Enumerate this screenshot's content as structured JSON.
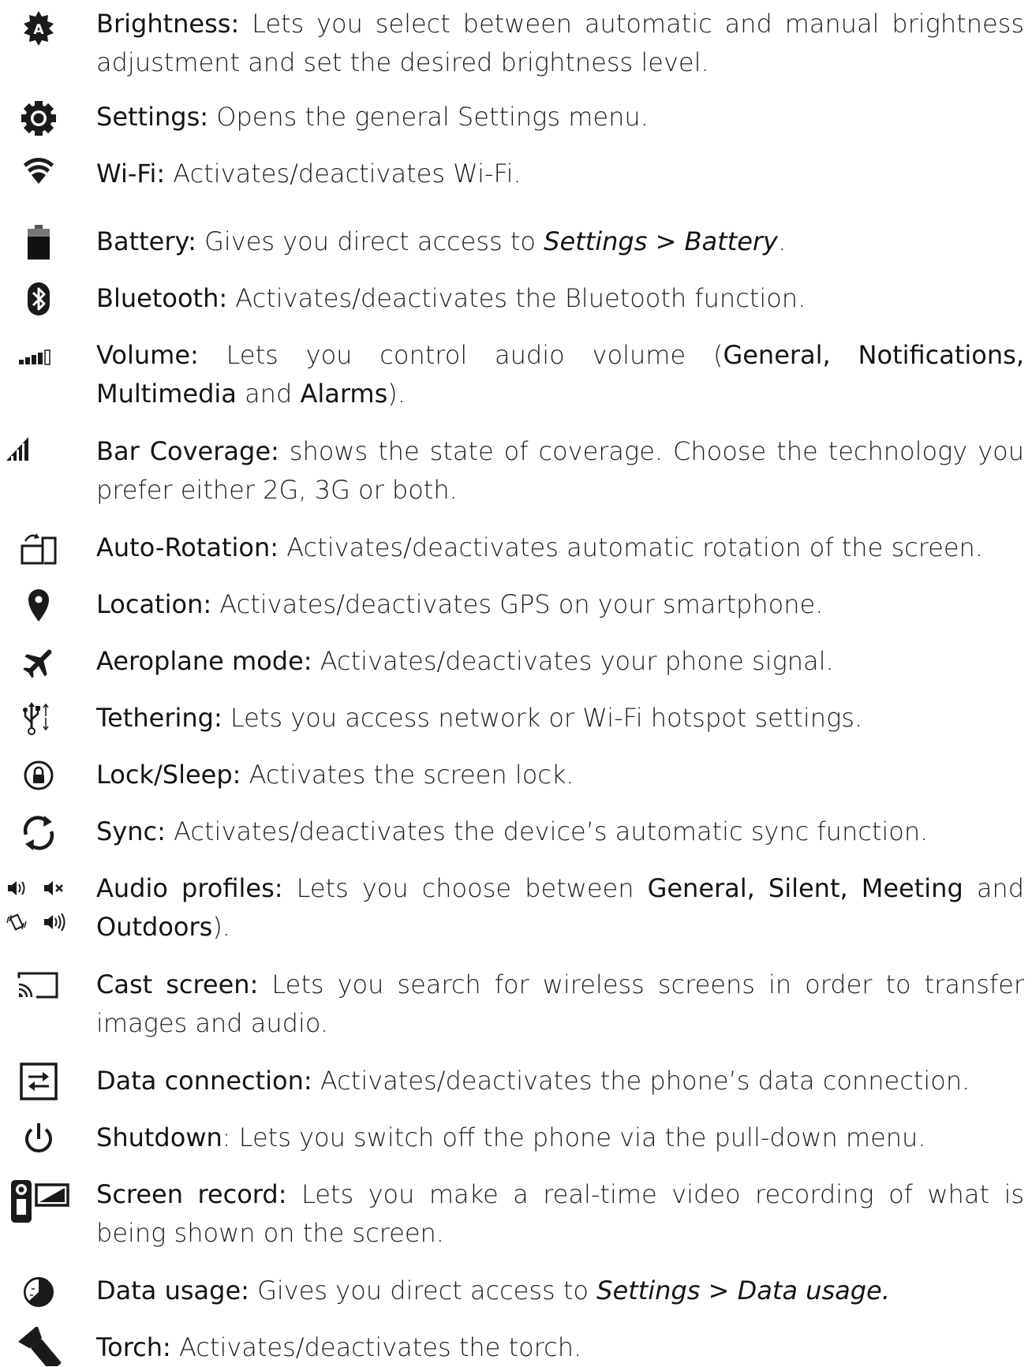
{
  "items": [
    {
      "icon": "brightness-auto-icon",
      "label": "Brightness:",
      "description": " Lets you select between automatic and manual brightness adjustment and set the desired brightness level."
    },
    {
      "icon": "settings-gear-icon",
      "label": "Settings:",
      "description": " Opens the general Settings menu."
    },
    {
      "icon": "wifi-icon",
      "label": "Wi-Fi:",
      "description": " Activates/deactivates Wi-Fi."
    },
    {
      "icon": "battery-icon",
      "label": "Battery:",
      "description_pre": " Gives you direct access to ",
      "description_em": "Settings > Battery",
      "description_post": "."
    },
    {
      "icon": "bluetooth-icon",
      "label": "Bluetooth:",
      "description": " Activates/deactivates the Bluetooth function."
    },
    {
      "icon": "volume-bars-icon",
      "label": "Volume:",
      "description_pre": " Lets you control audio volume  (",
      "bold1": "General, Notifications, Multimedia",
      "mid": " and ",
      "bold2": "Alarms",
      "description_post": ")."
    },
    {
      "icon": "signal-bars-icon",
      "label": "Bar Coverage:",
      "description": " shows the state of coverage. Choose the technology you prefer either 2G, 3G or both."
    },
    {
      "icon": "auto-rotation-icon",
      "label": "Auto-Rotation:",
      "description": " Activates/deactivates automatic rotation of the screen."
    },
    {
      "icon": "location-pin-icon",
      "label": "Location:",
      "description": " Activates/deactivates GPS on your smartphone."
    },
    {
      "icon": "aeroplane-icon",
      "label": "Aeroplane mode:",
      "description": " Activates/deactivates your phone signal."
    },
    {
      "icon": "usb-tethering-icon",
      "label": "Tethering:",
      "description": " Lets you access network or Wi-Fi hotspot settings."
    },
    {
      "icon": "lock-icon",
      "label": "Lock/Sleep:",
      "description": " Activates the screen lock."
    },
    {
      "icon": "sync-icon",
      "label": "Sync:",
      "description": " Activates/deactivates the device’s automatic sync function."
    },
    {
      "icon": "audio-profiles-icon",
      "label": "Audio profiles:",
      "description_pre": " Lets you choose between ",
      "bold1": "General, Silent, Meeting",
      "mid": " and ",
      "bold2": "Outdoors",
      "description_post": ")."
    },
    {
      "icon": "cast-screen-icon",
      "label": "Cast screen:",
      "description": " Lets you search for wireless screens in order to transfer images and audio."
    },
    {
      "icon": "data-connection-icon",
      "label": "Data connection:",
      "description": " Activates/deactivates the phone’s data connection."
    },
    {
      "icon": "power-icon",
      "label": "Shutdown",
      "description": ": Lets you switch off the phone via the pull-down menu."
    },
    {
      "icon": "screen-record-icon",
      "label": "Screen record:",
      "description": " Lets you make a real-time video recording of what is being shown on the screen."
    },
    {
      "icon": "data-usage-icon",
      "label": "Data usage:",
      "description_pre": " Gives you direct access to ",
      "description_em": "Settings > Data usage.",
      "description_post": ""
    },
    {
      "icon": "torch-icon",
      "label": "Torch:",
      "description": " Activates/deactivates the torch."
    }
  ]
}
